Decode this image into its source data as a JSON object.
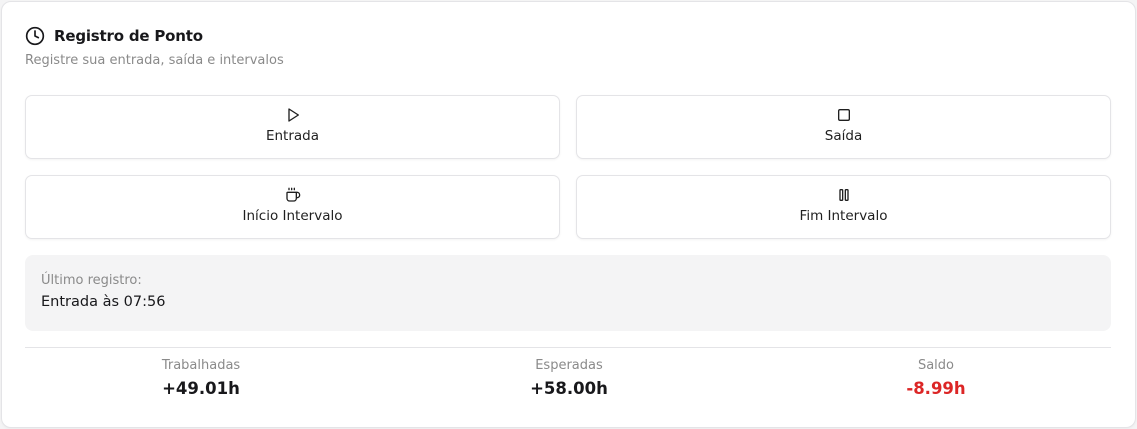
{
  "header": {
    "title": "Registro de Ponto",
    "subtitle": "Registre sua entrada, saída e intervalos",
    "icon": "clock-icon"
  },
  "actions": [
    {
      "label": "Entrada",
      "icon": "play-icon"
    },
    {
      "label": "Saída",
      "icon": "stop-square-icon"
    },
    {
      "label": "Início Intervalo",
      "icon": "coffee-cup-icon"
    },
    {
      "label": "Fim Intervalo",
      "icon": "pause-icon"
    }
  ],
  "last_record": {
    "caption": "Último registro:",
    "value": "Entrada às 07:56"
  },
  "stats": [
    {
      "label": "Trabalhadas",
      "value": "+49.01h"
    },
    {
      "label": "Esperadas",
      "value": "+58.00h"
    },
    {
      "label": "Saldo",
      "value": "-8.99h",
      "color": "#dc2626"
    }
  ]
}
